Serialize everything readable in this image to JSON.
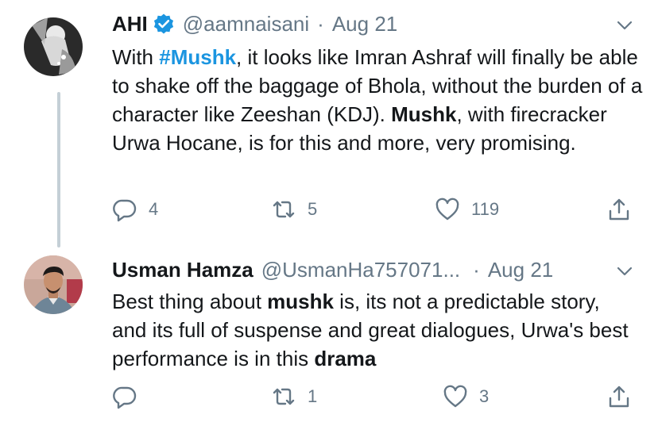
{
  "tweets": [
    {
      "name": "AHI",
      "verified": true,
      "handle": "@aamnaisani",
      "separator": "·",
      "date": "Aug 21",
      "text": {
        "hashtag": "#Mushk",
        "part1": "With ",
        "part2": ", it looks like Imran Ashraf will finally be able to shake off the baggage of Bhola, without the burden of a character like Zeeshan (KDJ). ",
        "bold1": "Mushk",
        "part3": ", with firecracker Urwa Hocane, is for this and more, very promising."
      },
      "replies": "4",
      "retweets": "5",
      "likes": "119"
    },
    {
      "name": "Usman Hamza",
      "verified": false,
      "handle": "@UsmanHa757071...",
      "separator": "·",
      "date": "Aug 21",
      "text": {
        "part1": "Best thing about ",
        "bold1": "mushk",
        "part2": " is, its not a predictable story, and its full of suspense and great dialogues, Urwa's best performance is in this ",
        "bold2": "drama"
      },
      "replies": "",
      "retweets": "1",
      "likes": "3"
    }
  ],
  "icons": {
    "verified": "verified-badge-icon",
    "caret": "chevron-down-icon",
    "reply": "reply-icon",
    "retweet": "retweet-icon",
    "like": "heart-icon",
    "share": "share-icon"
  },
  "colors": {
    "accent": "#1b95e0",
    "muted": "#657786",
    "text": "#14171a"
  }
}
